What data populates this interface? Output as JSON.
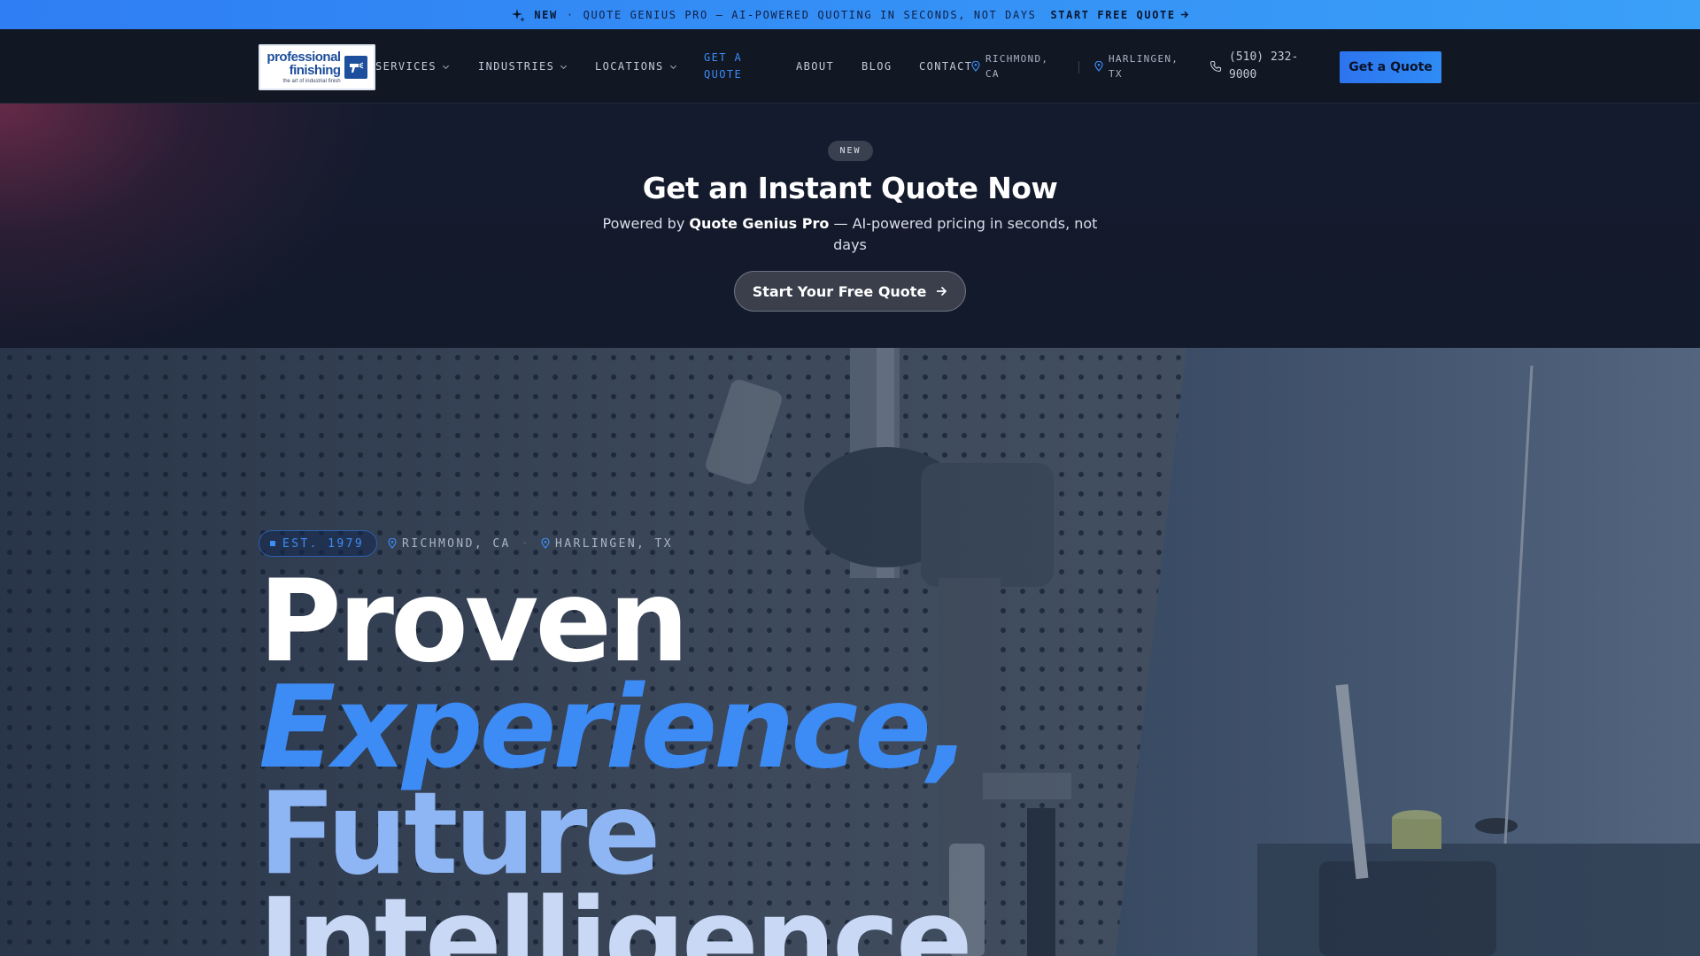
{
  "announcement": {
    "new_label": "NEW",
    "separator": "·",
    "message": "QUOTE GENIUS PRO — AI-POWERED QUOTING IN SECONDS, NOT DAYS",
    "cta": "START FREE QUOTE"
  },
  "header": {
    "logo": {
      "line1": "professional",
      "line2": "finishing",
      "tagline": "the art of industrial finish"
    },
    "nav": [
      {
        "label": "SERVICES"
      },
      {
        "label": "INDUSTRIES"
      },
      {
        "label": "LOCATIONS"
      },
      {
        "label_line1": "GET A",
        "label_line2": "QUOTE"
      },
      {
        "label": "ABOUT"
      },
      {
        "label": "BLOG"
      },
      {
        "label": "CONTACT"
      }
    ],
    "locations": [
      {
        "line1": "RICHMOND,",
        "line2": "CA"
      },
      {
        "line1": "HARLINGEN,",
        "line2": "TX"
      }
    ],
    "phone": {
      "line1": "(510) 232-",
      "line2": "9000"
    },
    "cta_label": "Get a Quote"
  },
  "quote_band": {
    "badge": "NEW",
    "title": "Get an Instant Quote Now",
    "subtitle_prefix": "Powered by ",
    "subtitle_bold": "Quote Genius Pro",
    "subtitle_suffix": " — AI-powered pricing in seconds, not days",
    "button_label": "Start Your Free Quote"
  },
  "hero": {
    "est_badge": "EST. 1979",
    "locations": [
      "RICHMOND, CA",
      "HARLINGEN, TX"
    ],
    "meta_separator": "·",
    "headline": [
      "Proven",
      "Experience,",
      "Future",
      "Intelligence"
    ]
  },
  "colors": {
    "announcement_bar": "#3394f6",
    "accent_blue": "#3d8cf6",
    "header_bg": "#111723",
    "quote_band_bg": "#131a2b"
  },
  "icons": {
    "announce": "sparkles-icon",
    "chevron": "chevron-down-icon",
    "location": "map-pin-icon",
    "phone": "phone-icon",
    "arrow": "arrow-right-icon"
  }
}
